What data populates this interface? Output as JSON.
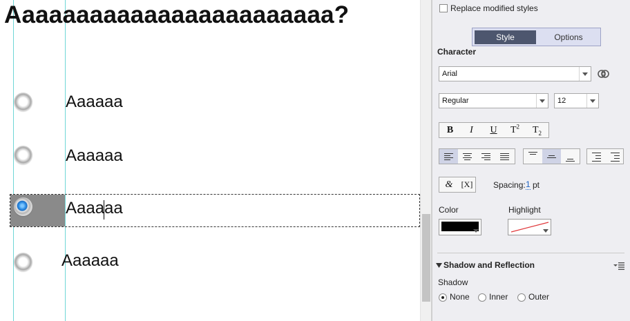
{
  "canvas": {
    "question": "Aaaaaaaaaaaaaaaaaaaaaaaa?",
    "answers": [
      {
        "label": "Aaaaaa",
        "selected": false
      },
      {
        "label": "Aaaaaa",
        "selected": false
      },
      {
        "label": "Aaaaaa",
        "selected": true
      },
      {
        "label": "Aaaaaa",
        "selected": false
      }
    ]
  },
  "panel": {
    "replace_styles_label": "Replace modified styles",
    "tabs": [
      {
        "label": "Style",
        "active": true
      },
      {
        "label": "Options",
        "active": false
      }
    ],
    "character": {
      "title": "Character",
      "font": "Arial",
      "style": "Regular",
      "size": "12",
      "format_buttons": [
        {
          "label": "B",
          "name": "bold"
        },
        {
          "label": "I",
          "name": "italic"
        },
        {
          "label": "U",
          "name": "underline"
        },
        {
          "label": "T",
          "sup": "2",
          "name": "superscript"
        },
        {
          "label": "T",
          "sub": "2",
          "name": "subscript"
        }
      ],
      "spacing_label": "Spacing:",
      "spacing_value": "1",
      "spacing_unit": "pt",
      "color_label": "Color",
      "highlight_label": "Highlight",
      "color_value": "#000000",
      "special_char_symbol": "&",
      "variable_symbol": "[X]"
    },
    "shadow": {
      "section_title": "Shadow and Reflection",
      "shadow_label": "Shadow",
      "options": [
        {
          "label": "None",
          "checked": true
        },
        {
          "label": "Inner",
          "checked": false
        },
        {
          "label": "Outer",
          "checked": false
        }
      ]
    }
  },
  "colors": {
    "guide": "#6fd6d6",
    "tab_active": "#4d566e",
    "radio_selected": "#2f8fe6",
    "selection_fill": "#8a8a8a"
  }
}
